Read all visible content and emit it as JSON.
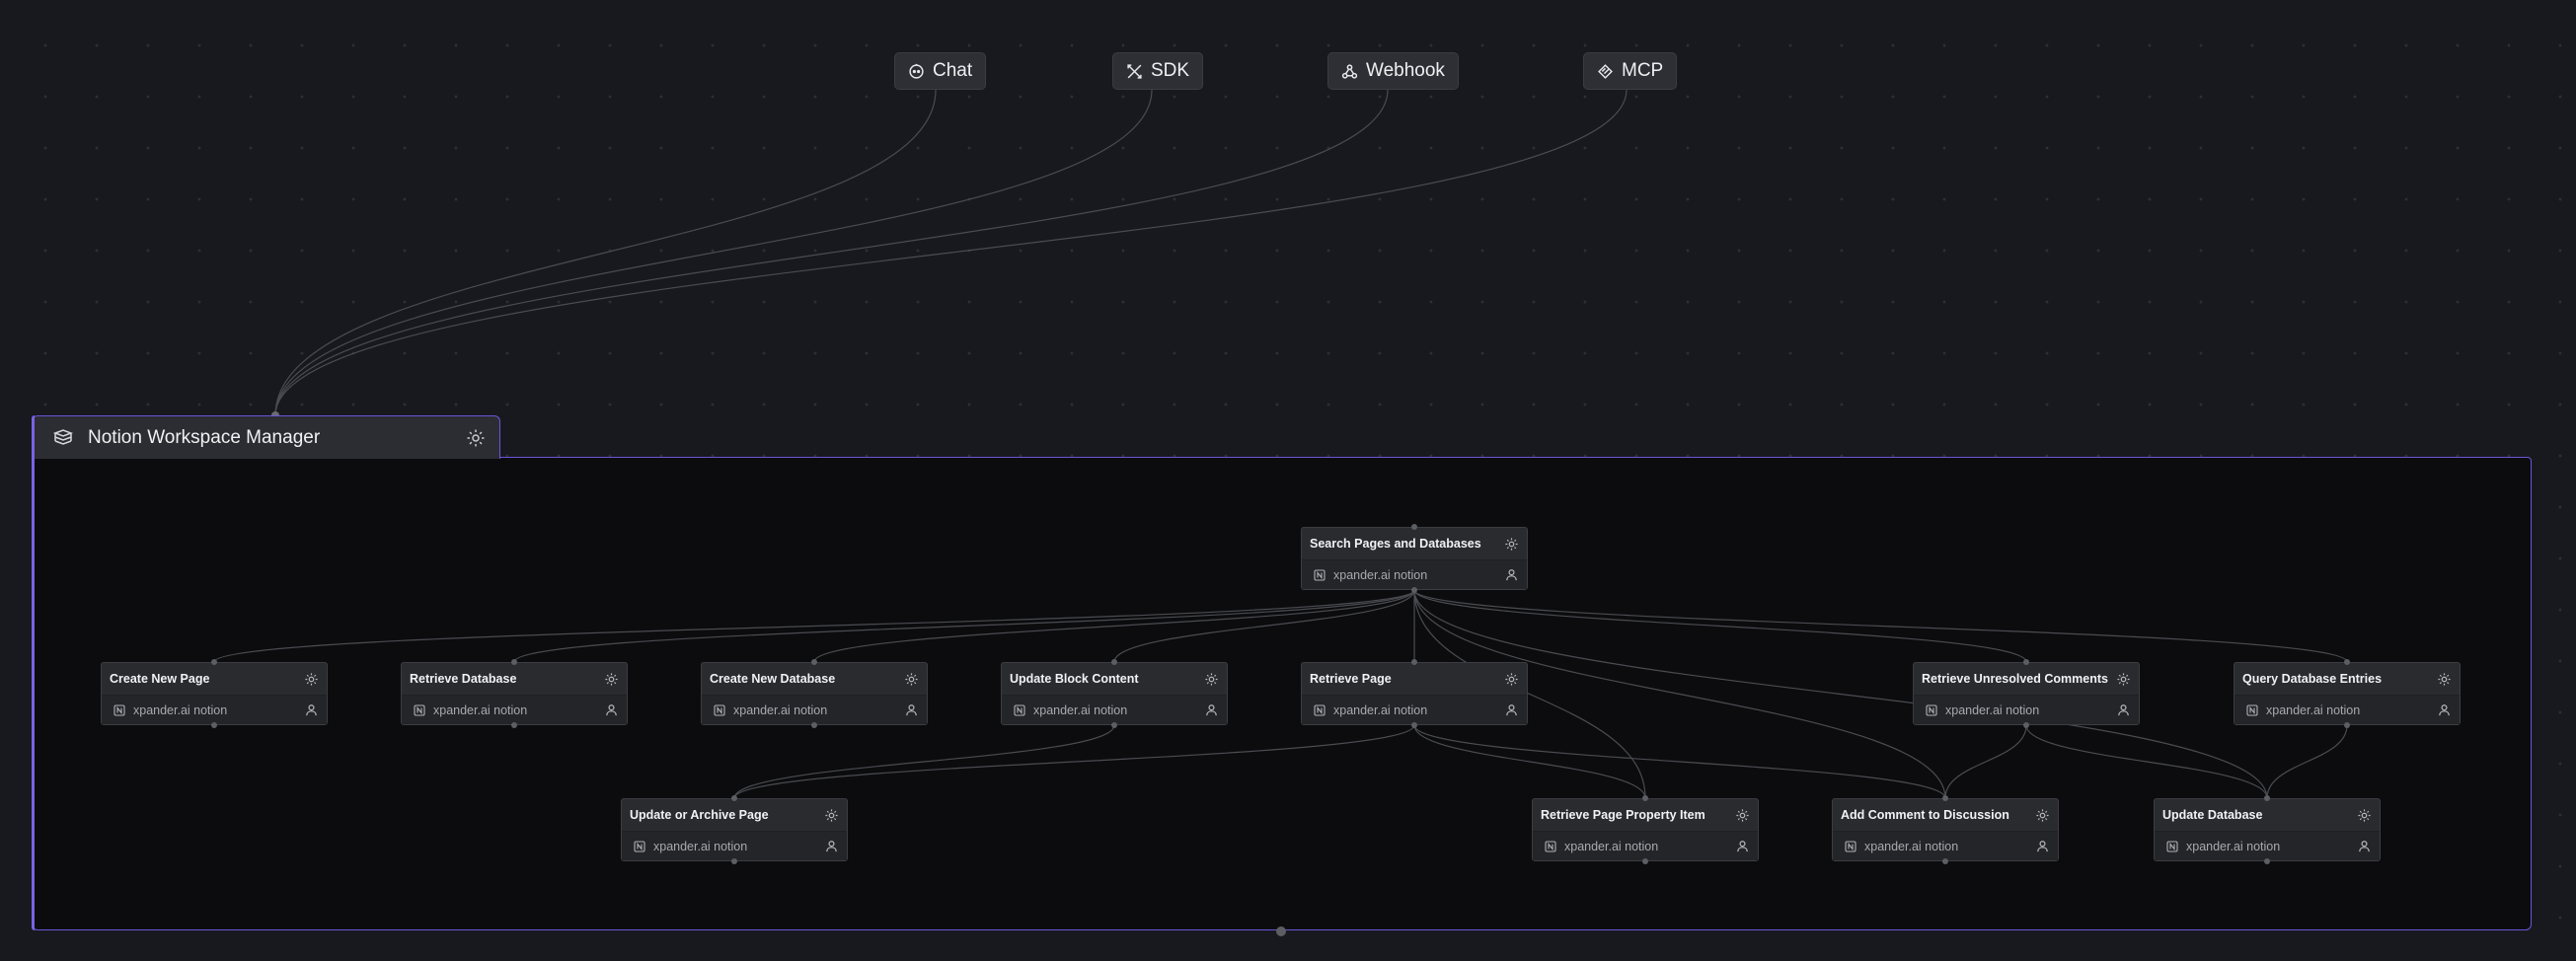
{
  "triggers": [
    {
      "label": "Chat",
      "icon": "chat-bot-icon"
    },
    {
      "label": "SDK",
      "icon": "sdk-tools-icon"
    },
    {
      "label": "Webhook",
      "icon": "webhook-icon"
    },
    {
      "label": "MCP",
      "icon": "mcp-icon"
    }
  ],
  "agent": {
    "title": "Notion Workspace Manager",
    "icon": "notion-cube-icon"
  },
  "nodes": [
    {
      "name": "Search Pages and Databases",
      "sub": "xpander.ai notion"
    },
    {
      "name": "Create New Page",
      "sub": "xpander.ai notion"
    },
    {
      "name": "Retrieve Database",
      "sub": "xpander.ai notion"
    },
    {
      "name": "Create New Database",
      "sub": "xpander.ai notion"
    },
    {
      "name": "Update Block Content",
      "sub": "xpander.ai notion"
    },
    {
      "name": "Retrieve Page",
      "sub": "xpander.ai notion"
    },
    {
      "name": "Retrieve Unresolved Comments",
      "sub": "xpander.ai notion"
    },
    {
      "name": "Query Database Entries",
      "sub": "xpander.ai notion"
    },
    {
      "name": "Update or Archive Page",
      "sub": "xpander.ai notion"
    },
    {
      "name": "Retrieve Page Property Item",
      "sub": "xpander.ai notion"
    },
    {
      "name": "Add Comment to Discussion",
      "sub": "xpander.ai notion"
    },
    {
      "name": "Update Database",
      "sub": "xpander.ai notion"
    }
  ],
  "colors": {
    "canvas": "#17191e",
    "frame": "#0c0c0e",
    "accent": "#6b55d8",
    "node": "#2a2b2f",
    "wire": "#4a4c52"
  }
}
